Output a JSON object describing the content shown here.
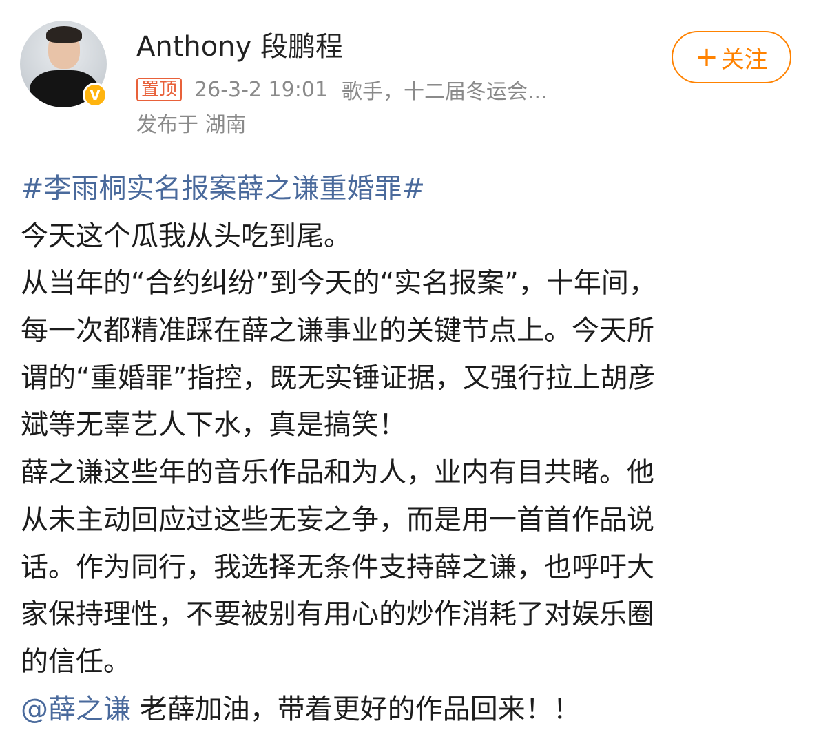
{
  "post": {
    "username": "Anthony 段鹏程",
    "verified_icon": "v-verified-badge",
    "verified_mark": "V",
    "pinned_label": "置顶",
    "time": "26-3-2 19:01",
    "source": "歌手，十二届冬运会...",
    "location": "发布于 湖南",
    "follow_button": {
      "plus": "+",
      "label": "关注"
    },
    "topic": "#李雨桐实名报案薛之谦重婚罪#",
    "body_lines": [
      "今天这个瓜我从头吃到尾。",
      "从当年的“合约纠纷”到今天的“实名报案”，十年间，",
      "每一次都精准踩在薛之谦事业的关键节点上。今天所",
      "谓的“重婚罪”指控，既无实锤证据，又强行拉上胡彦",
      "斌等无辜艺人下水，真是搞笑！",
      "薛之谦这些年的音乐作品和为人，业内有目共睹。他",
      "从未主动回应过这些无妄之争，而是用一首首作品说",
      "话。作为同行，我选择无条件支持薛之谦，也呼吁大",
      "家保持理性，不要被别有用心的炒作消耗了对娱乐圈",
      "的信任。"
    ],
    "mention": "@薛之谦",
    "final_text": " 老薛加油，带着更好的作品回来！！"
  },
  "colors": {
    "link_blue": "#4a6a9c",
    "follow_orange": "#ff8200",
    "pin_red": "#e8613a",
    "meta_gray": "#8a8a8a",
    "verified_gold": "#ffb40f"
  }
}
